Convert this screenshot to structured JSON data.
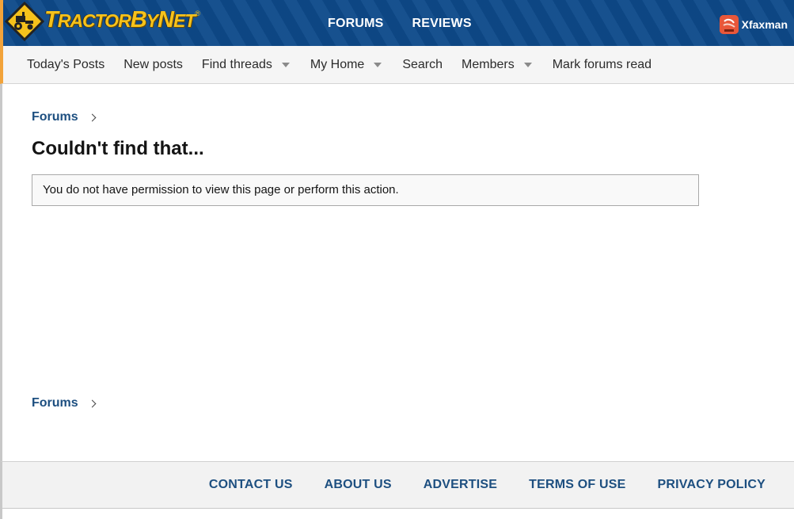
{
  "brand": {
    "name_part1": "T",
    "name_part2": "RACTOR",
    "name_part3": "B",
    "name_part4": "Y",
    "name_part5": "N",
    "name_part6": "ET",
    "registered": "®",
    "colors": {
      "header_bg": "#0e4a8a",
      "logo_yellow": "#f6c21b",
      "accent_orange": "#f2a33a"
    }
  },
  "topnav": {
    "forums": "FORUMS",
    "reviews": "REVIEWS"
  },
  "user": {
    "name": "Xfaxman",
    "avatar_icon": "avatar-icon"
  },
  "subnav": {
    "items": [
      {
        "label": "Today's Posts",
        "dropdown": false
      },
      {
        "label": "New posts",
        "dropdown": false
      },
      {
        "label": "Find threads",
        "dropdown": true
      },
      {
        "label": "My Home",
        "dropdown": true
      },
      {
        "label": "Search",
        "dropdown": false
      },
      {
        "label": "Members",
        "dropdown": true
      },
      {
        "label": "Mark forums read",
        "dropdown": false
      }
    ]
  },
  "breadcrumb": {
    "top": "Forums",
    "bottom": "Forums"
  },
  "main": {
    "title": "Couldn't find that...",
    "notice": "You do not have permission to view this page or perform this action."
  },
  "footer": {
    "links": [
      "CONTACT US",
      "ABOUT US",
      "ADVERTISE",
      "TERMS OF USE",
      "PRIVACY POLICY"
    ],
    "link_color": "#1d4f80"
  }
}
